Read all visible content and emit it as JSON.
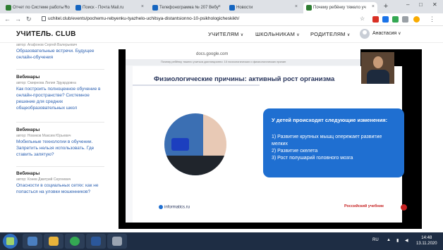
{
  "browser": {
    "tabs": [
      {
        "label": "Отчет по Системе работы по",
        "color": "#2e7d32"
      },
      {
        "label": "Поиск - Почта Mail.ru",
        "color": "#1565c0"
      },
      {
        "label": "Телефонограмма № 207 Вебу",
        "color": "#1565c0"
      },
      {
        "label": "Новости",
        "color": "#1565c0"
      },
      {
        "label": "Почему ребёнку тяжело уч",
        "color": "#2e7d32"
      }
    ],
    "url": "uchitel.club/events/pochemu-rebyenku-tyazhelo-uchitsya-distantsionno-10-psikhologicheskikh/"
  },
  "site": {
    "logo": "УЧИТЕЛЬ. CLUB",
    "nav": [
      "УЧИТЕЛЯМ",
      "ШКОЛЬНИКАМ",
      "РОДИТЕЛЯМ"
    ],
    "user": "Анастасия"
  },
  "sidebar": {
    "posts": [
      {
        "category": "",
        "author": "автор: Агафонов Сергей Валерьевич",
        "title": "Образовательные встречи. Будущее онлайн-обучения"
      },
      {
        "category": "Вебинары",
        "author": "автор: Смирнова Лилия Эдуардовна",
        "title": "Как построить полноценное обучение в онлайн-пространстве? Системное решение для средних общеобразовательных школ"
      },
      {
        "category": "Вебинары",
        "author": "автор: Новиков Максим Юрьевич",
        "title": "Мобильные технологии в обучении. Запретить нельзя использовать. Где ставить запятую?"
      },
      {
        "category": "Вебинары",
        "author": "автор: Конев Дмитрий Сергеевич",
        "title": "Опасности в социальных сетях: как не попасться на уловки мошенников?"
      }
    ]
  },
  "shared_screen": {
    "domain": "docs.google.com",
    "subbar": "Почему ребёнку тяжело учиться дистанционно: 10 психологических и физиологических причин",
    "slide": {
      "title": "Физиологические причины: активный рост организма",
      "box_head": "У детей происходят следующие изменения:",
      "items": [
        "1) Развитие крупных мышц опережает развитие мелких",
        "2) Развитие скелета",
        "3) Рост полушарий головного мозга"
      ],
      "footer_logo": "informatics.ru",
      "partner_logo": "Российский учебник"
    }
  },
  "taskbar": {
    "lang": "RU",
    "time": "14:48",
    "date": "13.11.2020"
  }
}
